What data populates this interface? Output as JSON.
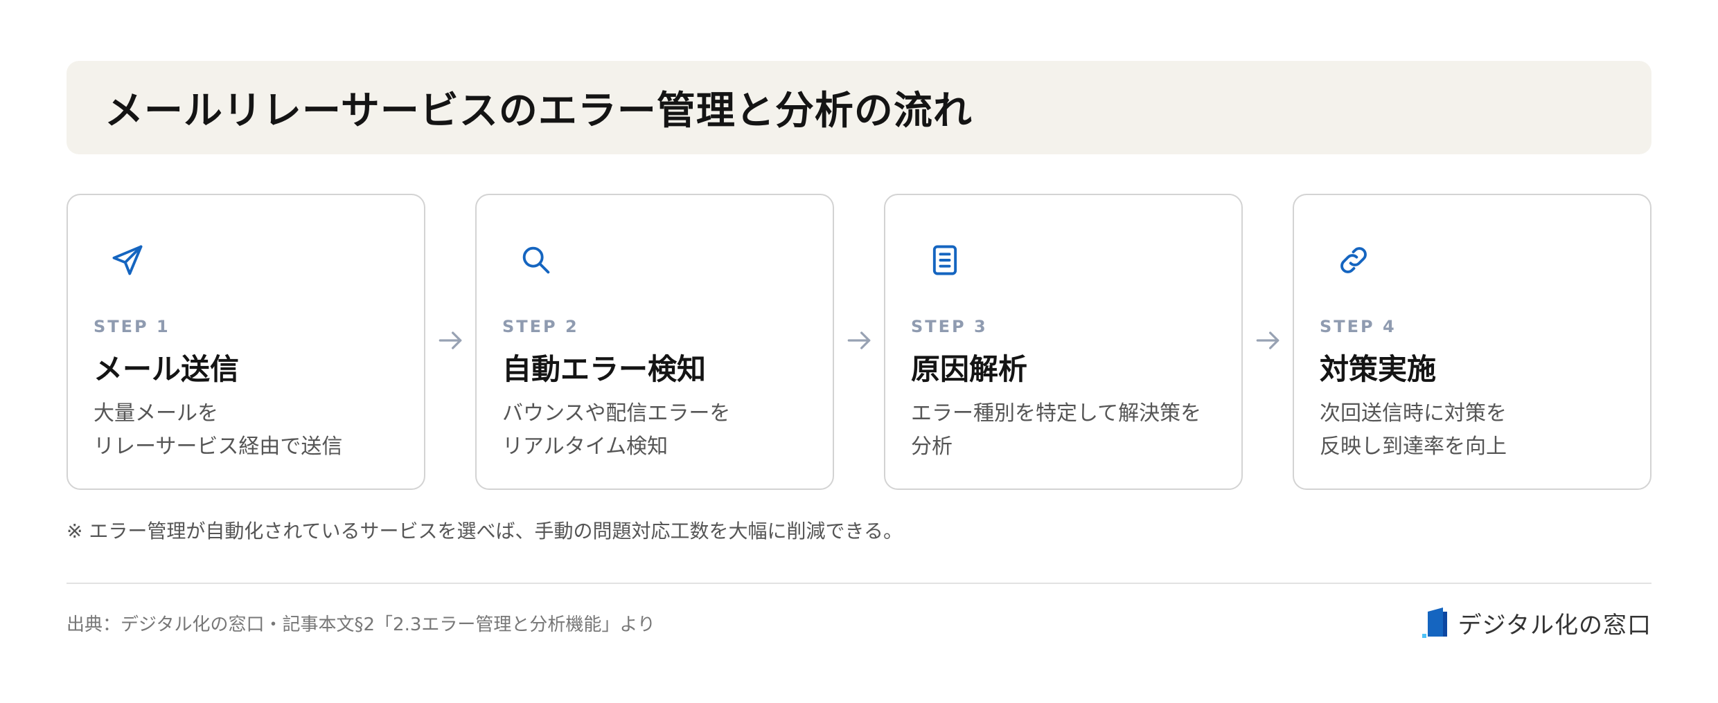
{
  "header": {
    "title": "メールリレーサービスのエラー管理と分析の流れ"
  },
  "steps": [
    {
      "label": "STEP 1",
      "title": "メール送信",
      "desc": [
        "大量メールを",
        "リレーサービス経由で送信"
      ],
      "icon": "send-icon"
    },
    {
      "label": "STEP 2",
      "title": "自動エラー検知",
      "desc": [
        "バウンスや配信エラーを",
        "リアルタイム検知"
      ],
      "icon": "search-icon"
    },
    {
      "label": "STEP 3",
      "title": "原因解析",
      "desc": [
        "エラー種別を特定して解決策を",
        "分析"
      ],
      "icon": "document-icon"
    },
    {
      "label": "STEP 4",
      "title": "対策実施",
      "desc": [
        "次回送信時に対策を",
        "反映し到達率を向上"
      ],
      "icon": "link-icon"
    }
  ],
  "note": "※ エラー管理が自動化されているサービスを選べば、手動の問題対応工数を大幅に削減できる。",
  "footer": {
    "source": "出典：デジタル化の窓口・記事本文§2「2.3エラー管理と分析機能」より",
    "brand": "デジタル化の窓口"
  },
  "colors": {
    "accent": "#1565c0",
    "title_bg": "#f4f2ec",
    "step_label": "#8f9bb0",
    "arrow": "#98a2b3"
  }
}
